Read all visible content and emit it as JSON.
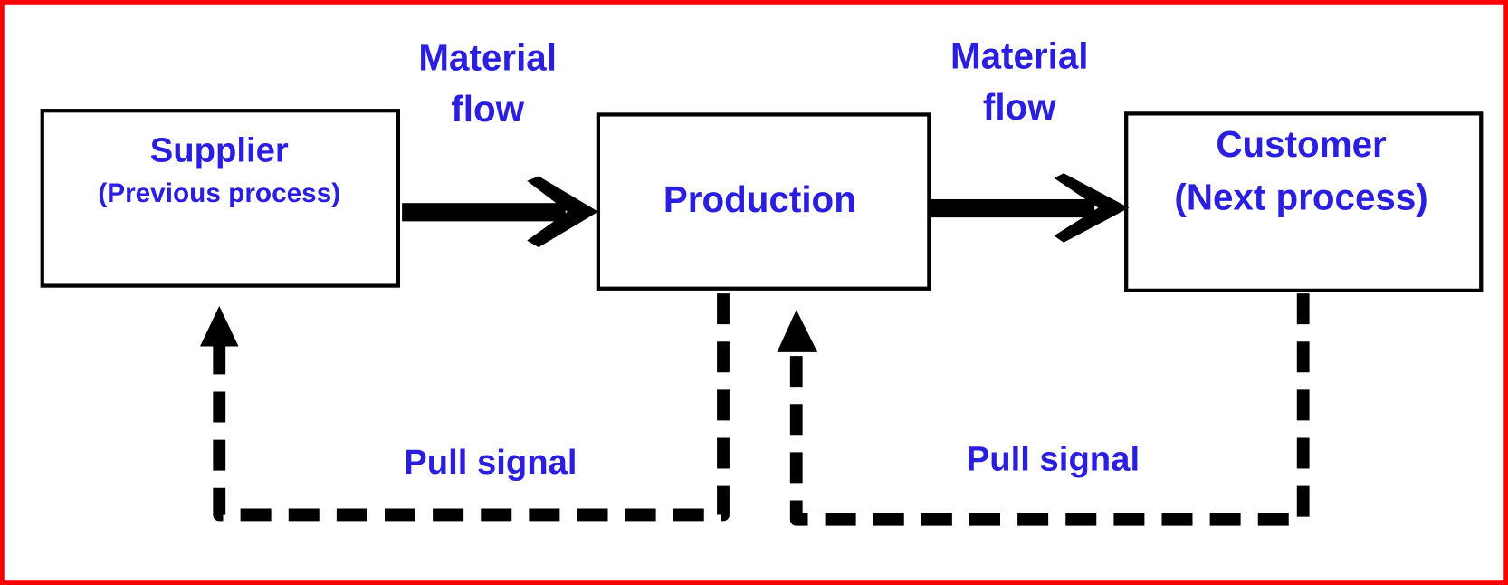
{
  "colors": {
    "border": "#ff0000",
    "text": "#2a1ee0",
    "lines": "#000000",
    "background": "#ffffff"
  },
  "nodes": {
    "supplier": {
      "title": "Supplier",
      "subtitle": "(Previous process)"
    },
    "production": {
      "title": "Production"
    },
    "customer": {
      "title": "Customer",
      "subtitle": "(Next process)"
    }
  },
  "edges": {
    "material_flow_1": {
      "line1": "Material",
      "line2": "flow"
    },
    "material_flow_2": {
      "line1": "Material",
      "line2": "flow"
    },
    "pull_signal_1": {
      "label": "Pull signal"
    },
    "pull_signal_2": {
      "label": "Pull signal"
    }
  }
}
